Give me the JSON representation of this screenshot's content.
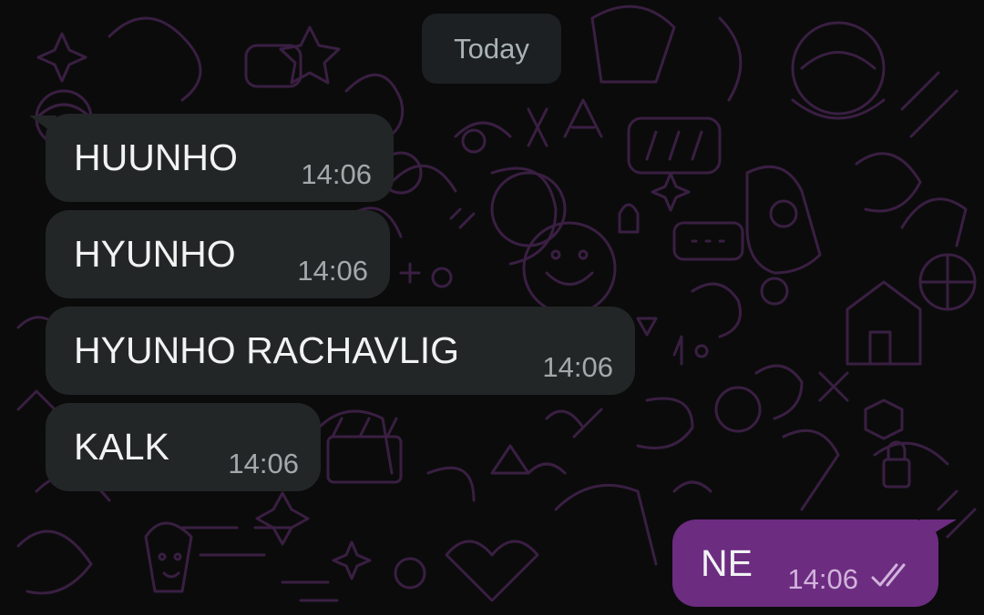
{
  "day_separator": "Today",
  "messages_in": [
    {
      "text": "HUUNHO",
      "time": "14:06"
    },
    {
      "text": "HYUNHO",
      "time": "14:06"
    },
    {
      "text": "HYUNHO RACHAVLIG",
      "time": "14:06"
    },
    {
      "text": "KALK",
      "time": "14:06"
    }
  ],
  "message_out": {
    "text": "NE",
    "time": "14:06",
    "status": "read-checks-icon"
  },
  "colors": {
    "background": "#0b0b0c",
    "incoming_bubble": "#232626",
    "outgoing_bubble": "#6c2c80",
    "wallpaper_doodles": "#3a1f42"
  }
}
